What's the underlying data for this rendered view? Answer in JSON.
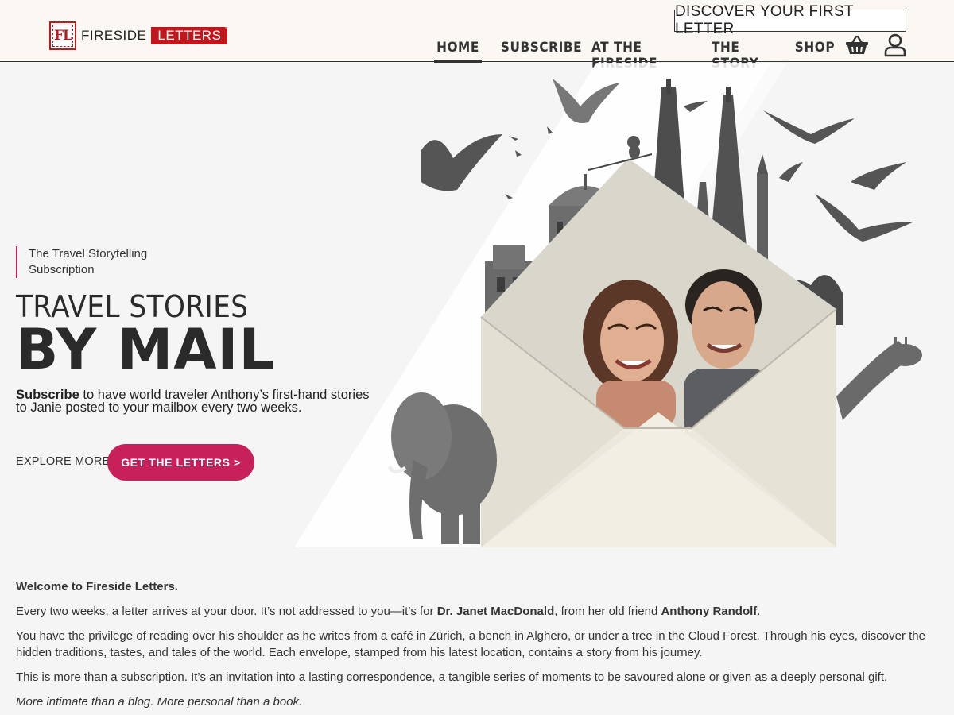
{
  "header": {
    "logo_mark": "FL",
    "logo_word1": "FIRESIDE",
    "logo_word2": "LETTERS",
    "discover_label": "DISCOVER YOUR FIRST LETTER",
    "nav": [
      {
        "label": "HOME",
        "active": true
      },
      {
        "label": "SUBSCRIBE",
        "active": false
      },
      {
        "label": "AT THE FIRESIDE",
        "active": false
      },
      {
        "label": "THE STORY",
        "active": false
      },
      {
        "label": "SHOP",
        "active": false
      }
    ],
    "icons": [
      "basket-icon",
      "user-icon"
    ]
  },
  "hero": {
    "tagline": "The Travel Storytelling Subscription",
    "title_line1": "TRAVEL STORIES",
    "title_line2": "BY MAIL",
    "desc_bold": "Subscribe",
    "desc_rest": " to have world traveler Anthony’s first-hand stories to Janie posted to your mailbox every two weeks.",
    "explore_label": "EXPLORE MORE",
    "cta_label": "GET THE LETTERS >"
  },
  "content": {
    "welcome": "Welcome to Fireside Letters.",
    "p1_pre": "Every two weeks, a letter arrives at your door. It’s not addressed to you—it’s for ",
    "p1_name1": "Dr. Janet MacDonald",
    "p1_mid": ", from her old friend ",
    "p1_name2": "Anthony Randolf",
    "p1_end": ".",
    "p2": "You have the privilege of reading over his shoulder as he writes from a café in Zürich, a bench in Alghero, or under a tree in the Cloud Forest. Through his eyes, discover the hidden traditions, tastes, and tales of the world. Each envelope, stamped from his latest location, contains a story from his journey.",
    "p3": "This is more than a subscription. It’s an invitation into a lasting correspondence, a tangible series of moments to be savoured alone or given as a deeply personal gift.",
    "p4": "More intimate than a blog. More personal than a book."
  },
  "colors": {
    "accent": "#c8205a",
    "logo_red": "#c0171c",
    "header_bg": "#fbf8f3",
    "page_bg": "#f5f5f5"
  }
}
